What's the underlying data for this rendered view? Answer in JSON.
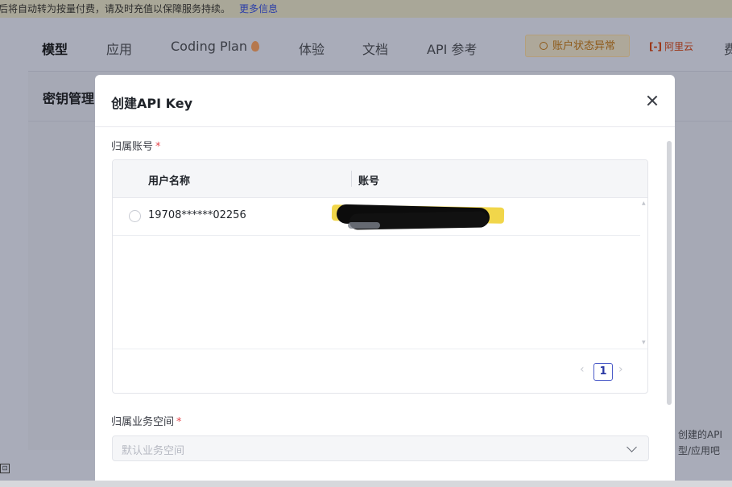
{
  "banner": {
    "text": "后将自动转为按量付费，请及时充值以保障服务持续。",
    "more_link": "更多信息"
  },
  "nav": {
    "items": [
      "模型",
      "应用",
      "Coding Plan",
      "体验",
      "文档",
      "API 参考"
    ],
    "account_status": "账户状态异常",
    "brand": "阿里云",
    "brand_logo": "[-]",
    "cut_item": "费"
  },
  "page": {
    "title": "密钥管理",
    "empty_text_line1": "创建的API",
    "empty_text_line2": "型/应用吧"
  },
  "modal": {
    "title": "创建API Key",
    "account_label": "归属账号",
    "required_mark": "*",
    "table": {
      "columns": [
        "用户名称",
        "账号"
      ],
      "rows": [
        {
          "user_name": "19708******02256",
          "account": ""
        }
      ]
    },
    "pagination": {
      "prev": "‹",
      "current_page": "1",
      "next": "›"
    },
    "workspace_label": "归属业务空间",
    "workspace_placeholder": "默认业务空间"
  }
}
